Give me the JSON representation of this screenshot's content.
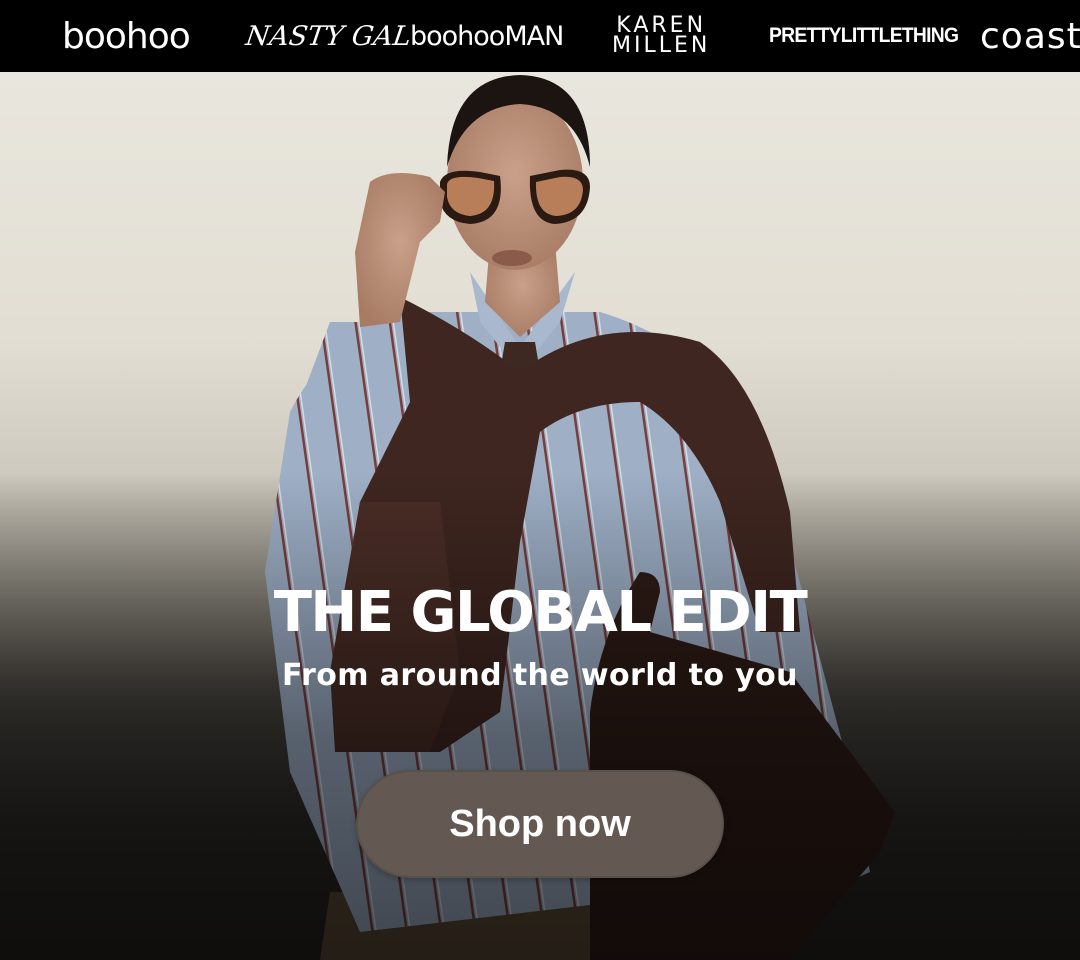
{
  "brands": [
    {
      "name": "boohoo"
    },
    {
      "name": "NASTY GAL"
    },
    {
      "name": "boohooMAN"
    },
    {
      "name_line1": "KAREN",
      "name_line2": "MILLEN"
    },
    {
      "name": "PRETTYLITTLETHING"
    },
    {
      "name": "coast"
    }
  ],
  "hero": {
    "title": "THE GLOBAL EDIT",
    "subtitle": "From around the world to you",
    "cta_label": "Shop now",
    "cta_color": "#645852"
  }
}
